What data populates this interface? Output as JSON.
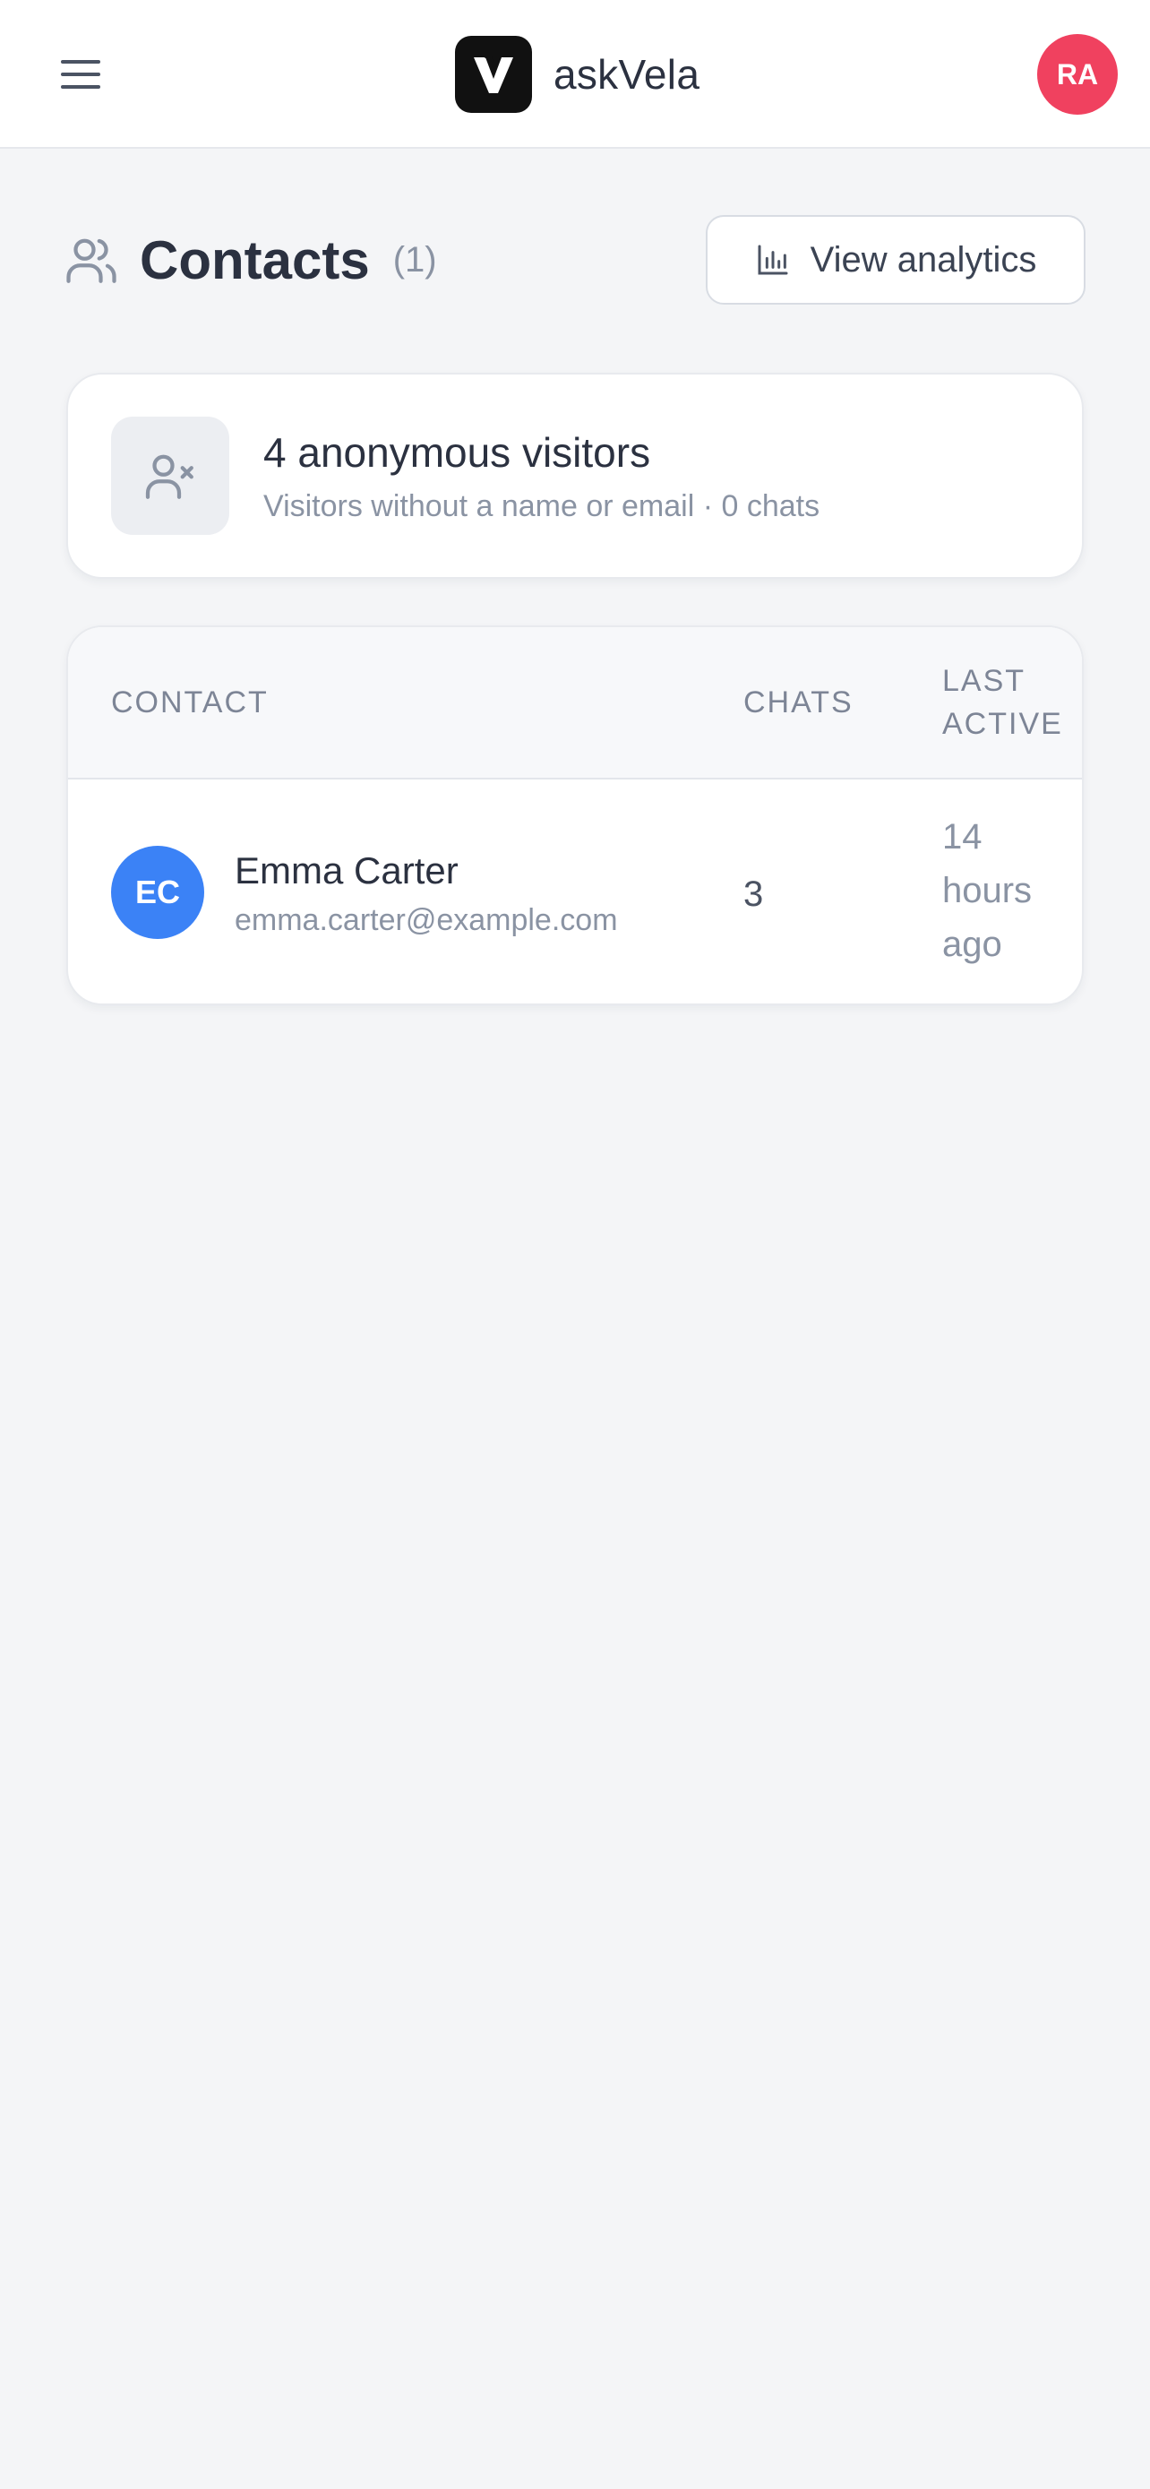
{
  "header": {
    "menu_icon": "hamburger-menu-icon",
    "brand_logo_icon": "vela-v-logo-icon",
    "brand_name": "askVela",
    "user_initials": "RA",
    "user_avatar_color": "#f0415f"
  },
  "page": {
    "title": "Contacts",
    "count": "(1)",
    "title_icon": "users-icon",
    "analytics_button_label": "View analytics",
    "analytics_icon": "bar-chart-icon"
  },
  "anonymous": {
    "icon": "user-x-icon",
    "title": "4 anonymous visitors",
    "subtitle": "Visitors without a name or email · 0 chats"
  },
  "table": {
    "columns": {
      "contact": "Contact",
      "chats": "Chats",
      "last_active": "Last active"
    },
    "rows": [
      {
        "initials": "EC",
        "avatar_color": "#3b82f6",
        "name": "Emma Carter",
        "email": "emma.carter@example.com",
        "chats": "3",
        "last_active": "14 hours ago"
      }
    ]
  }
}
